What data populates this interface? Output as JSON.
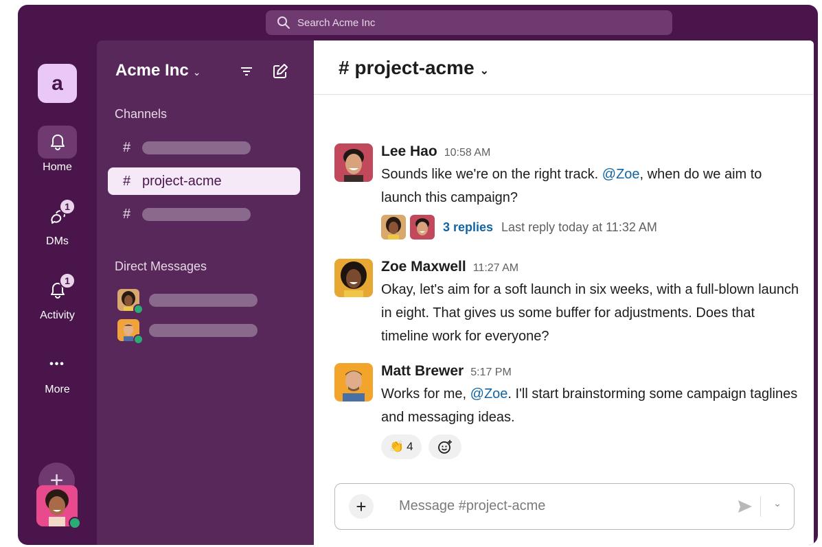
{
  "search": {
    "placeholder": "Search Acme Inc"
  },
  "workspace": {
    "logo_letter": "a",
    "name": "Acme Inc"
  },
  "rail": {
    "items": [
      {
        "label": "Home",
        "icon": "bell-icon"
      },
      {
        "label": "DMs",
        "icon": "dm-bubble-icon",
        "badge": "1"
      },
      {
        "label": "Activity",
        "icon": "bell-icon",
        "badge": "1"
      },
      {
        "label": "More",
        "icon": "more-dots-icon",
        "glyph": "•••"
      }
    ],
    "add_glyph": "+"
  },
  "sidebar": {
    "channels_title": "Channels",
    "channels": [
      {
        "hash": "#",
        "label": ""
      },
      {
        "hash": "#",
        "label": "project-acme",
        "active": true
      },
      {
        "hash": "#",
        "label": ""
      }
    ],
    "dm_title": "Direct Messages"
  },
  "channel": {
    "title": "# project-acme",
    "chevron": "⌄"
  },
  "messages": [
    {
      "author": "Lee Hao",
      "time": "10:58 AM",
      "text_before": "Sounds like we're on the right track. ",
      "mention": "@Zoe",
      "text_after": ", when do we aim to launch this campaign?",
      "thread": {
        "replies": "3 replies",
        "last": "Last reply today at 11:32 AM"
      }
    },
    {
      "author": "Zoe Maxwell",
      "time": "11:27 AM",
      "text": "Okay, let's aim for a soft launch in six weeks, with a full-blown launch in eight. That gives us some buffer for adjustments. Does that timeline work for everyone?"
    },
    {
      "author": "Matt Brewer",
      "time": "5:17 PM",
      "text_before": "Works for me, ",
      "mention": "@Zoe",
      "text_after": ". I'll start brainstorming some campaign taglines and messaging ideas.",
      "reactions": [
        {
          "emoji": "👏",
          "count": "4"
        }
      ]
    }
  ],
  "composer": {
    "placeholder": "Message #project-acme",
    "add_glyph": "+"
  },
  "colors": {
    "aubergine": "#4a154b",
    "sidebar": "#572859",
    "link": "#1264a3",
    "online": "#2bac76"
  }
}
